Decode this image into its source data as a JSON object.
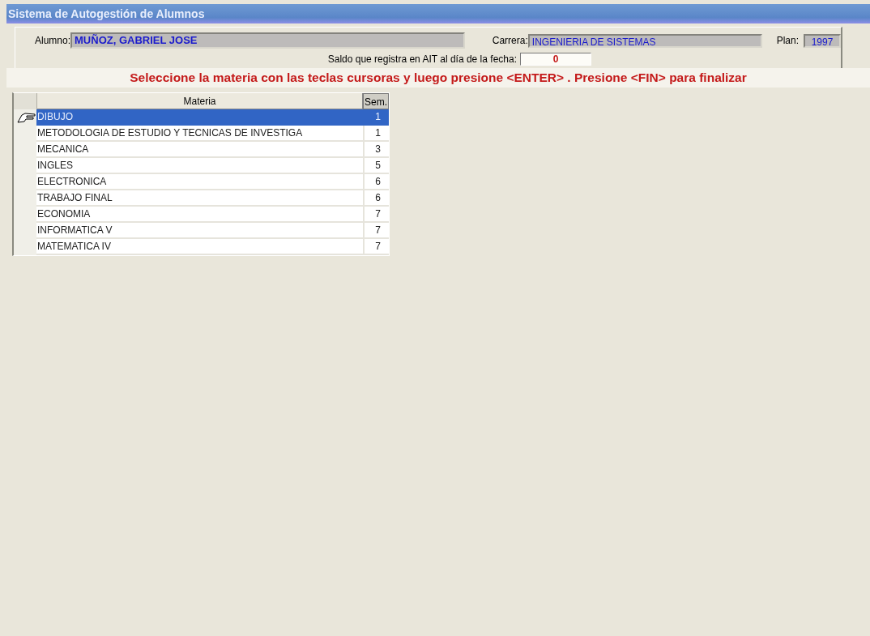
{
  "window": {
    "title": "Sistema de Autogestión de Alumnos"
  },
  "student": {
    "label": "Alumno:",
    "value": "MUÑOZ, GABRIEL JOSE"
  },
  "career": {
    "label": "Carrera:",
    "value": "INGENIERIA DE SISTEMAS"
  },
  "plan": {
    "label": "Plan:",
    "value": "1997"
  },
  "balance": {
    "label": "Saldo que registra en AIT al día de la fecha:",
    "value": "0"
  },
  "instruction": "Seleccione la materia con las teclas cursoras y luego presione <ENTER> . Presione <FIN> para finalizar",
  "table": {
    "columns": [
      "Materia",
      "Sem."
    ],
    "rows": [
      {
        "subject": "DIBUJO",
        "semester": "1",
        "selected": true
      },
      {
        "subject": "METODOLOGIA DE ESTUDIO Y TECNICAS DE INVESTIGA",
        "semester": "1",
        "selected": false
      },
      {
        "subject": "MECANICA",
        "semester": "3",
        "selected": false
      },
      {
        "subject": "INGLES",
        "semester": "5",
        "selected": false
      },
      {
        "subject": "ELECTRONICA",
        "semester": "6",
        "selected": false
      },
      {
        "subject": "TRABAJO FINAL",
        "semester": "6",
        "selected": false
      },
      {
        "subject": "ECONOMIA",
        "semester": "7",
        "selected": false
      },
      {
        "subject": "INFORMATICA V",
        "semester": "7",
        "selected": false
      },
      {
        "subject": "MATEMATICA IV",
        "semester": "7",
        "selected": false
      }
    ]
  }
}
